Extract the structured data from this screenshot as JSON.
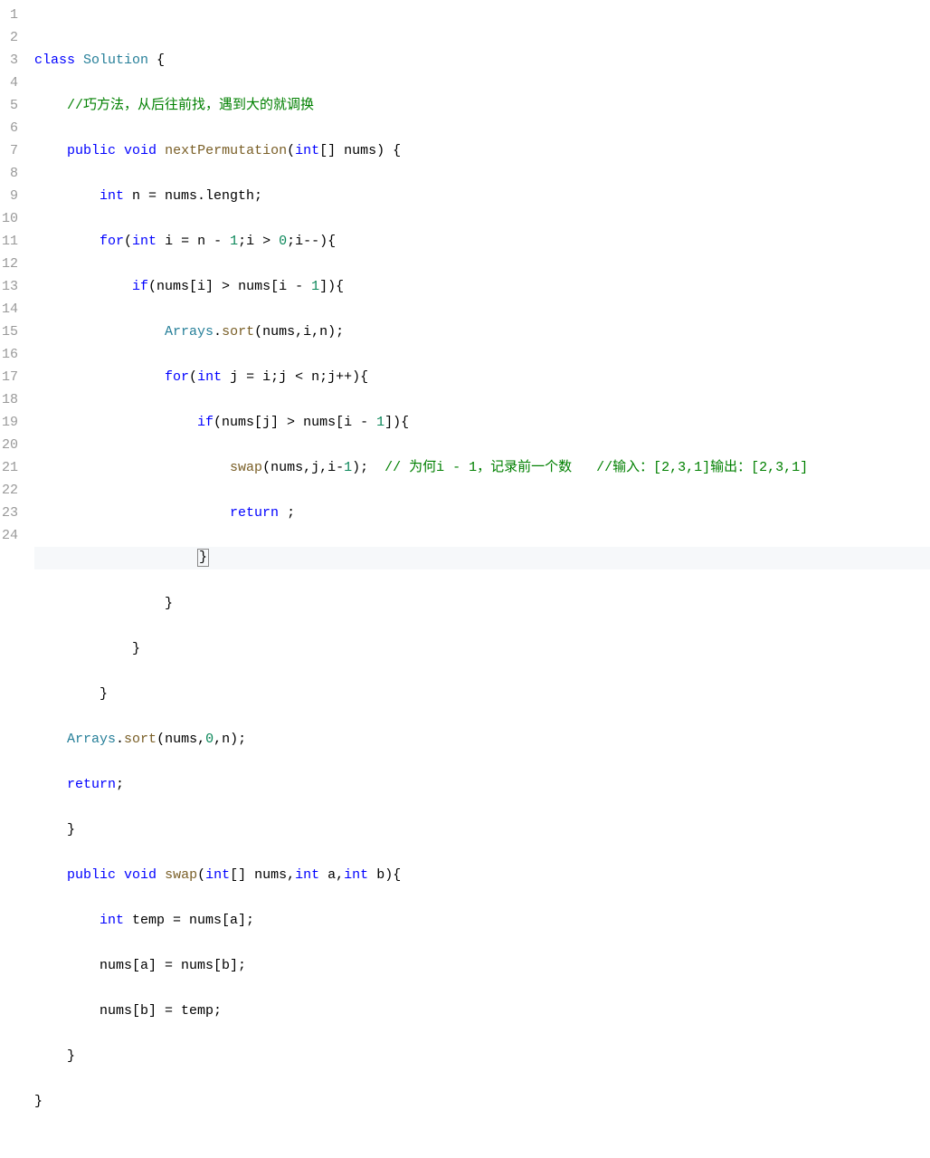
{
  "lines": [
    "1",
    "2",
    "3",
    "4",
    "5",
    "6",
    "7",
    "8",
    "9",
    "10",
    "11",
    "12",
    "13",
    "14",
    "15",
    "16",
    "17",
    "18",
    "19",
    "20",
    "21",
    "22",
    "23",
    "24"
  ],
  "code": {
    "l1": {
      "kw1": "class",
      "type": "Solution",
      "t1": " {"
    },
    "l2": {
      "cm": "//巧方法，从后往前找，遇到大的就调换"
    },
    "l3": {
      "kw1": "public",
      "kw2": "void",
      "fn": "nextPermutation",
      "sig": "(",
      "kw3": "int",
      "sig2": "[] nums) {"
    },
    "l4": {
      "kw1": "int",
      "t1": " n = nums.length;"
    },
    "l5": {
      "kw1": "for",
      "t1": "(",
      "kw2": "int",
      "t2": " i = n - ",
      "n1": "1",
      "t3": ";i > ",
      "n2": "0",
      "t4": ";i--){"
    },
    "l6": {
      "kw1": "if",
      "t1": "(nums[i] > nums[i - ",
      "n1": "1",
      "t2": "]){"
    },
    "l7": {
      "cls": "Arrays",
      "t1": ".",
      "fn": "sort",
      "t2": "(nums,i,n);"
    },
    "l8": {
      "kw1": "for",
      "t1": "(",
      "kw2": "int",
      "t2": " j = i;j < n;j++){"
    },
    "l9": {
      "kw1": "if",
      "t1": "(nums[j] > nums[i - ",
      "n1": "1",
      "t2": "]){"
    },
    "l10": {
      "fn": "swap",
      "t1": "(nums,j,i-",
      "n1": "1",
      "t2": ");  ",
      "cm1": "// 为何i - 1，记录前一个数   ",
      "cm2": "//输入：[2,3,1]输出：[2,3,1]"
    },
    "l11": {
      "kw1": "return",
      "t1": " ;"
    },
    "l12": {
      "t1": "}"
    },
    "l13": {
      "t1": "}"
    },
    "l14": {
      "t1": "}"
    },
    "l15": {
      "t1": "}"
    },
    "l16": {
      "cls": "Arrays",
      "t1": ".",
      "fn": "sort",
      "t2": "(nums,",
      "n1": "0",
      "t3": ",n);"
    },
    "l17": {
      "kw1": "return",
      "t1": ";"
    },
    "l18": {
      "t1": "}"
    },
    "l19": {
      "kw1": "public",
      "kw2": "void",
      "fn": "swap",
      "t1": "(",
      "kw3": "int",
      "t2": "[] nums,",
      "kw4": "int",
      "t3": " a,",
      "kw5": "int",
      "t4": " b){"
    },
    "l20": {
      "kw1": "int",
      "t1": " temp = nums[a];"
    },
    "l21": {
      "t1": "nums[a] = nums[b];"
    },
    "l22": {
      "t1": "nums[b] = temp;"
    },
    "l23": {
      "t1": "}"
    },
    "l24": {
      "t1": "}"
    }
  },
  "indent": {
    "l1": "",
    "l2": "    ",
    "l3": "    ",
    "l4": "        ",
    "l5": "        ",
    "l6": "            ",
    "l7": "                ",
    "l8": "                ",
    "l9": "                    ",
    "l10": "                        ",
    "l11": "                        ",
    "l12": "                    ",
    "l13": "                ",
    "l14": "            ",
    "l15": "        ",
    "l16": "    ",
    "l17": "    ",
    "l18": "    ",
    "l19": "    ",
    "l20": "        ",
    "l21": "        ",
    "l22": "        ",
    "l23": "    ",
    "l24": ""
  }
}
